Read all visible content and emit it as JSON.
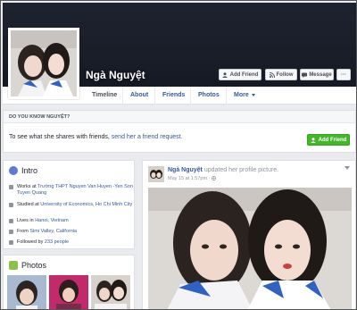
{
  "profile": {
    "name": "Ngà Nguyệt"
  },
  "actions": {
    "add_friend": "Add Friend",
    "follow": "Follow",
    "message": "Message",
    "more": "···"
  },
  "nav": {
    "tabs": [
      {
        "label": "Timeline"
      },
      {
        "label": "About"
      },
      {
        "label": "Friends"
      },
      {
        "label": "Photos"
      },
      {
        "label": "More"
      }
    ]
  },
  "know_panel": {
    "heading": "DO YOU KNOW NGUYỆT?",
    "text_prefix": "To see what she shares with friends, ",
    "link_text": "send her a friend request.",
    "button": "Add Friend"
  },
  "intro": {
    "title": "Intro",
    "rows": [
      {
        "prefix": "Works at ",
        "link": "Trường THPT Nguyen Van Huyen -Yen Son Tuyen Quang"
      },
      {
        "prefix": "Studied at ",
        "link": "University of Economics, Ho Chi Minh City"
      },
      {
        "prefix": "Lives in ",
        "link": "Hanoi, Vietnam"
      },
      {
        "prefix": "From ",
        "link": "Simi Valley, California"
      },
      {
        "prefix": "Followed by ",
        "link": "233 people"
      }
    ]
  },
  "photos": {
    "title": "Photos"
  },
  "post": {
    "author": "Ngà Nguyệt",
    "action": " updated her profile picture.",
    "time": "May 15 at 1:57pm · "
  },
  "colors": {
    "link": "#365899",
    "green": "#42b72a",
    "cover": "#1a1e29"
  }
}
